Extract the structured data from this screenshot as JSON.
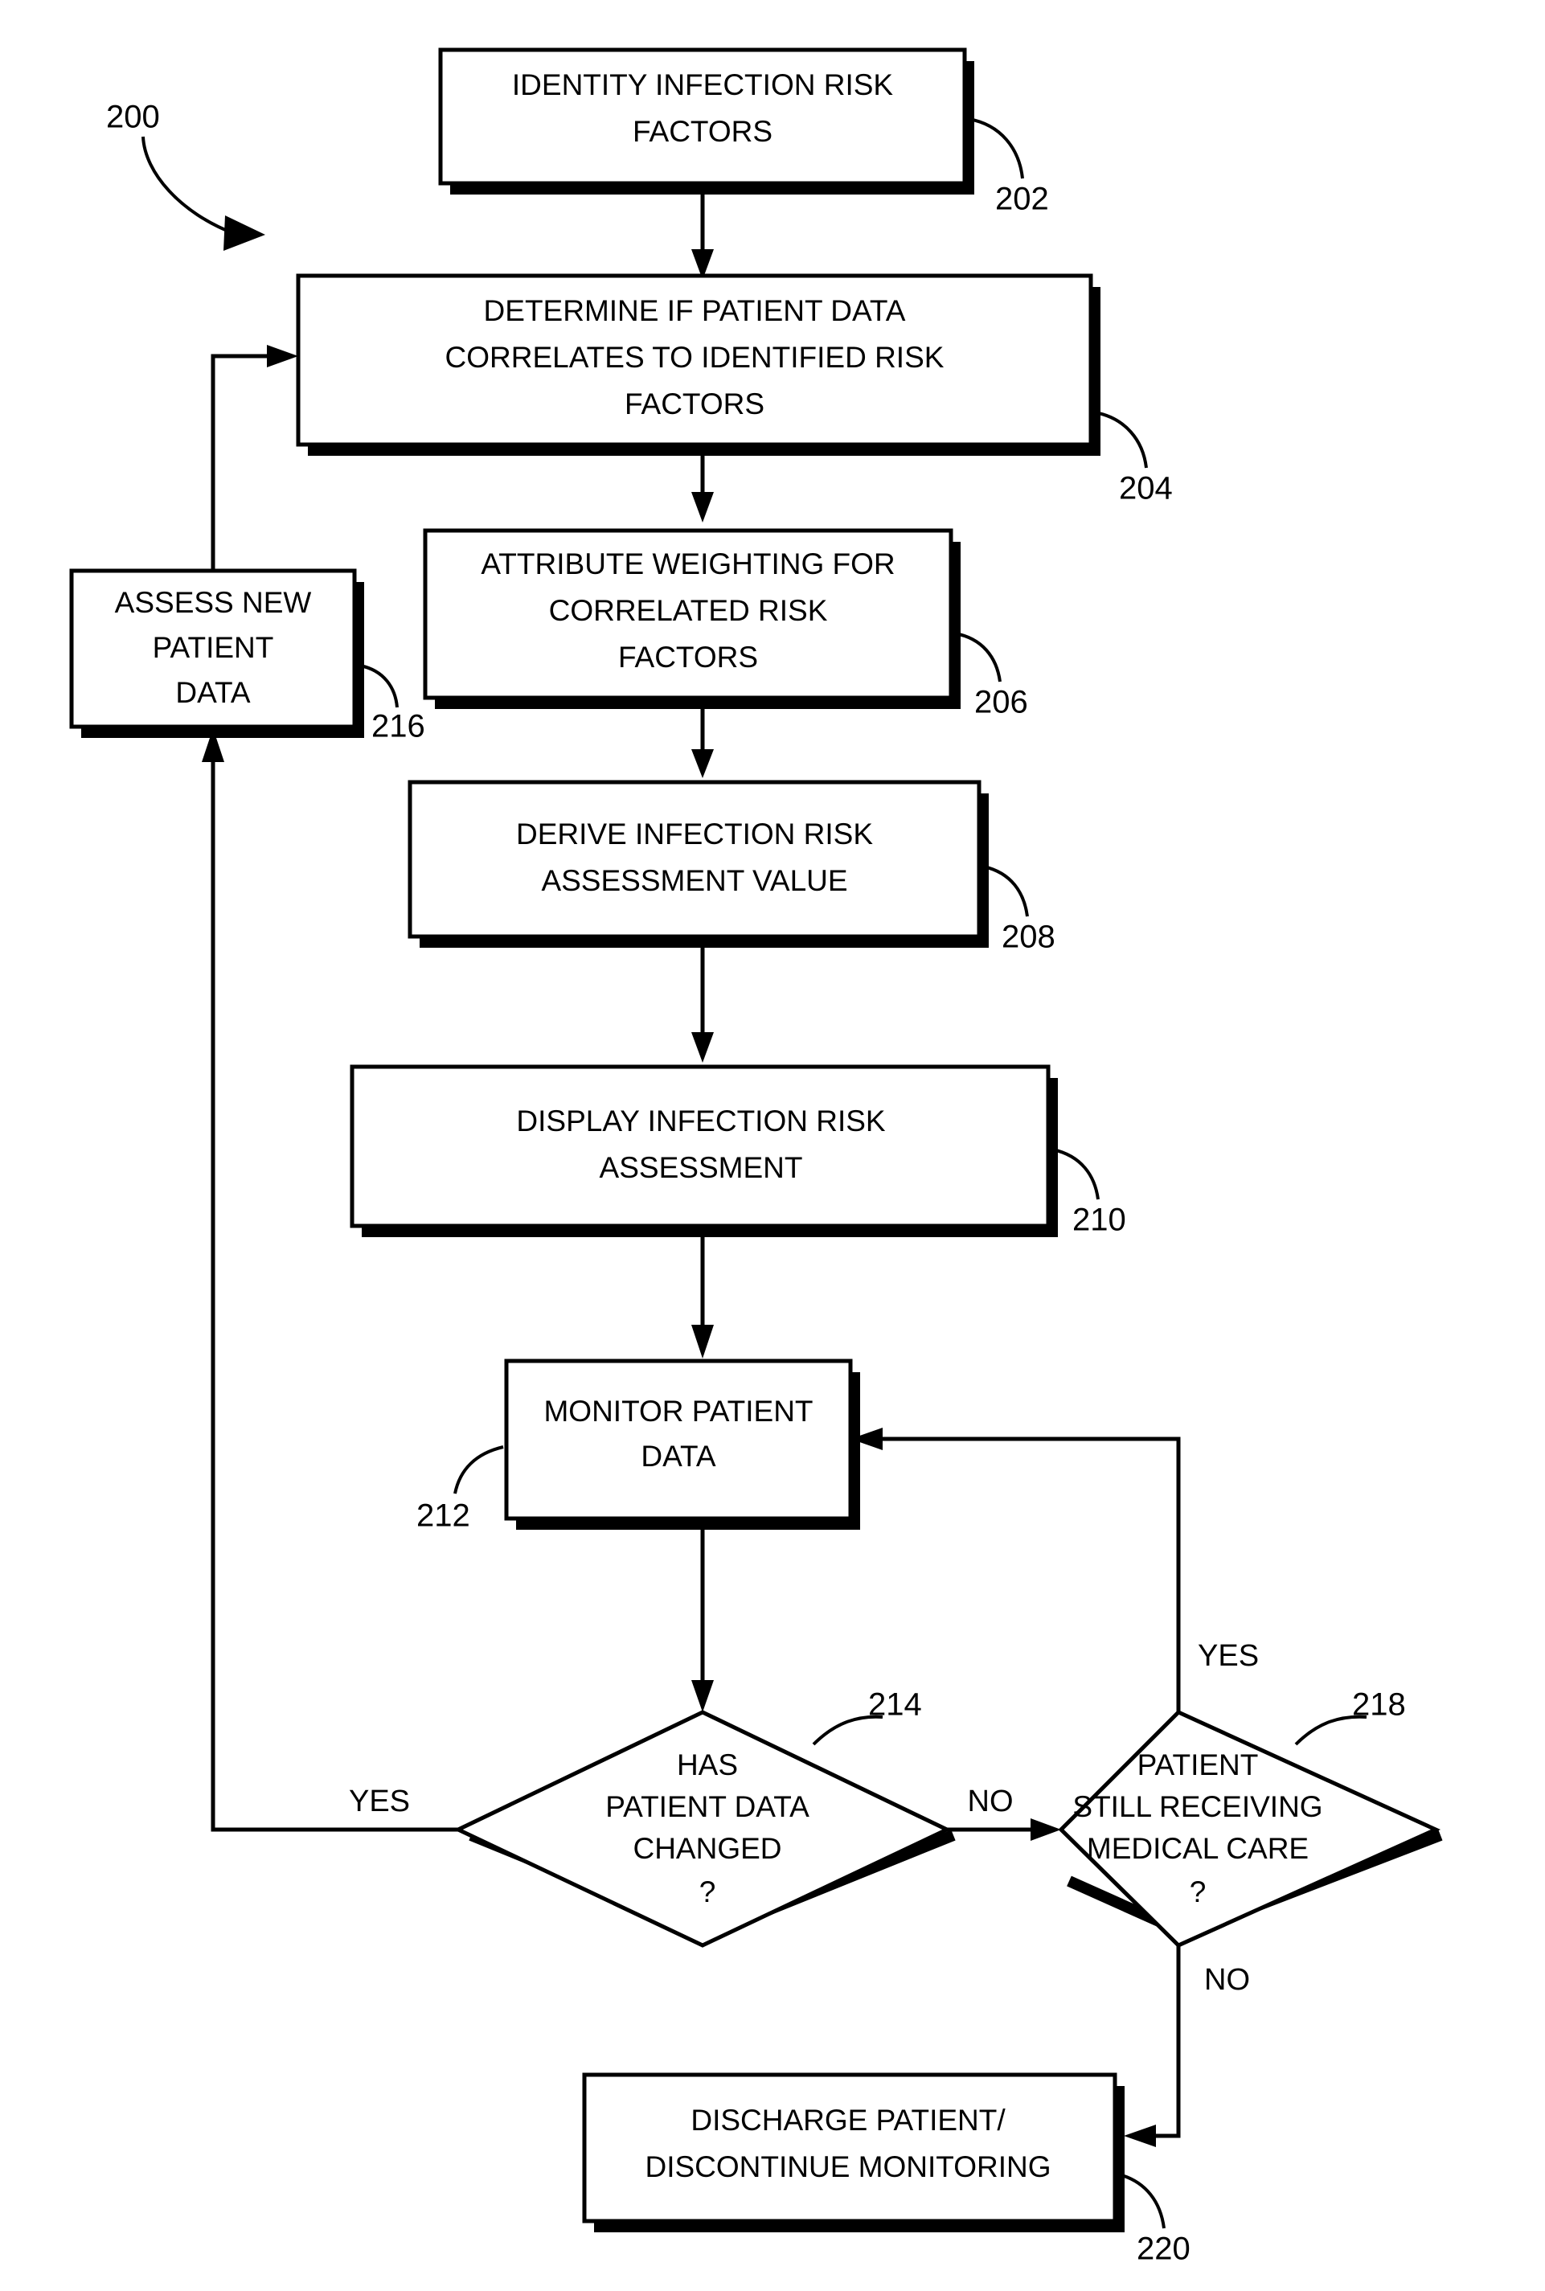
{
  "figure": {
    "figure_ref": "200",
    "nodes": [
      {
        "id": "202",
        "ref": "202",
        "shape": "process",
        "lines": [
          "IDENTITY INFECTION RISK",
          "FACTORS"
        ]
      },
      {
        "id": "204",
        "ref": "204",
        "shape": "process",
        "lines": [
          "DETERMINE IF PATIENT DATA",
          "CORRELATES TO IDENTIFIED RISK",
          "FACTORS"
        ]
      },
      {
        "id": "206",
        "ref": "206",
        "shape": "process",
        "lines": [
          "ATTRIBUTE WEIGHTING FOR",
          "CORRELATED RISK",
          "FACTORS"
        ]
      },
      {
        "id": "208",
        "ref": "208",
        "shape": "process",
        "lines": [
          "DERIVE INFECTION RISK",
          "ASSESSMENT VALUE"
        ]
      },
      {
        "id": "210",
        "ref": "210",
        "shape": "process",
        "lines": [
          "DISPLAY INFECTION RISK",
          "ASSESSMENT"
        ]
      },
      {
        "id": "212",
        "ref": "212",
        "shape": "process",
        "lines": [
          "MONITOR PATIENT",
          "DATA"
        ]
      },
      {
        "id": "214",
        "ref": "214",
        "shape": "decision",
        "lines": [
          "HAS",
          "PATIENT DATA",
          "CHANGED",
          "?"
        ]
      },
      {
        "id": "216",
        "ref": "216",
        "shape": "process",
        "lines": [
          "ASSESS NEW",
          "PATIENT",
          "DATA"
        ]
      },
      {
        "id": "218",
        "ref": "218",
        "shape": "decision",
        "lines": [
          "PATIENT",
          "STILL RECEIVING",
          "MEDICAL CARE",
          "?"
        ]
      },
      {
        "id": "220",
        "ref": "220",
        "shape": "process",
        "lines": [
          "DISCHARGE PATIENT/",
          "DISCONTINUE MONITORING"
        ]
      }
    ],
    "edge_labels": {
      "decision_214_yes": "YES",
      "decision_214_no": "NO",
      "decision_218_yes": "YES",
      "decision_218_no": "NO"
    },
    "colors": {
      "ink": "#000000",
      "paper": "#ffffff"
    }
  }
}
